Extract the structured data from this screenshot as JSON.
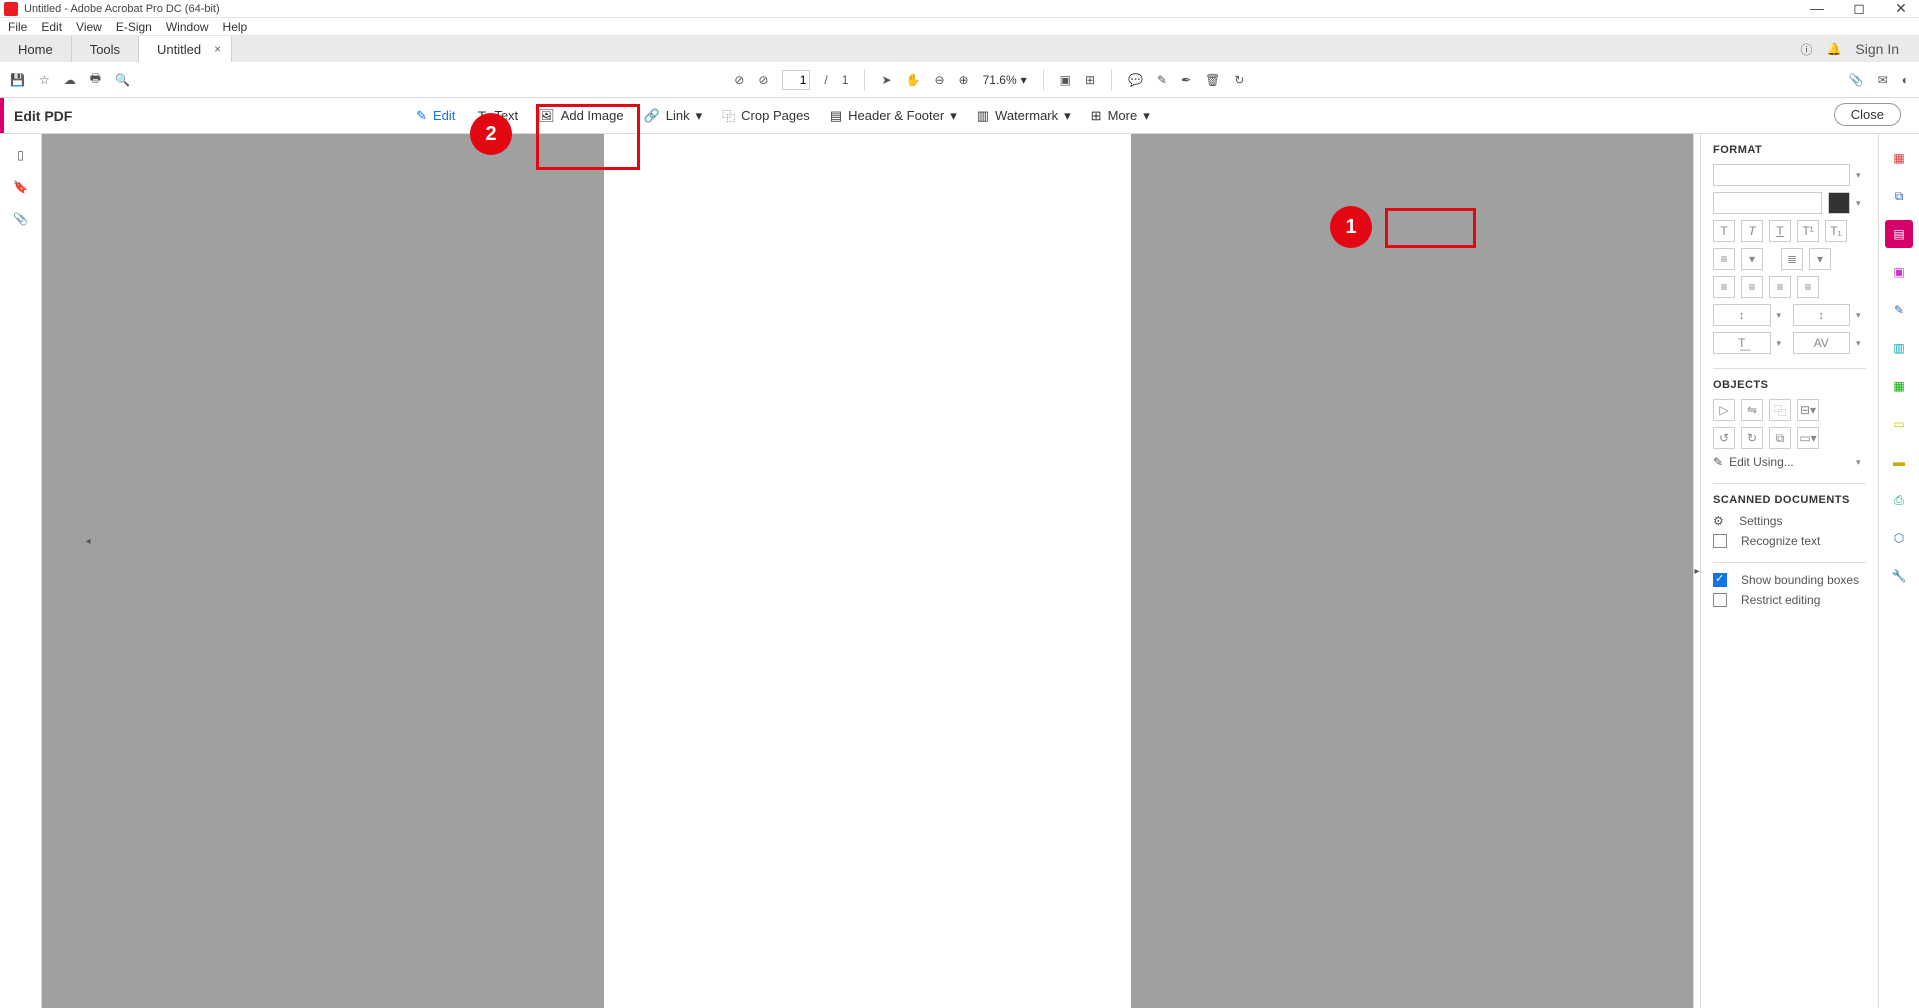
{
  "window": {
    "title": "Untitled - Adobe Acrobat Pro DC (64-bit)"
  },
  "menubar": [
    "File",
    "Edit",
    "View",
    "E-Sign",
    "Window",
    "Help"
  ],
  "tabs": {
    "home": "Home",
    "tools": "Tools",
    "doc": "Untitled",
    "signin": "Sign In"
  },
  "toolbar": {
    "page_current": "1",
    "page_sep": "/",
    "page_total": "1",
    "zoom": "71.6%"
  },
  "subbar": {
    "title": "Edit PDF",
    "edit": "Edit",
    "add_text": "Text",
    "add_image": "Add Image",
    "link": "Link",
    "crop": "Crop Pages",
    "header": "Header & Footer",
    "watermark": "Watermark",
    "more": "More",
    "close": "Close"
  },
  "format": {
    "heading": "FORMAT",
    "objects": "OBJECTS",
    "edit_using": "Edit Using...",
    "scanned": "SCANNED DOCUMENTS",
    "settings": "Settings",
    "recognize": "Recognize text",
    "show_bbox": "Show bounding boxes",
    "restrict": "Restrict editing"
  },
  "annotations": {
    "one": "1",
    "two": "2"
  }
}
